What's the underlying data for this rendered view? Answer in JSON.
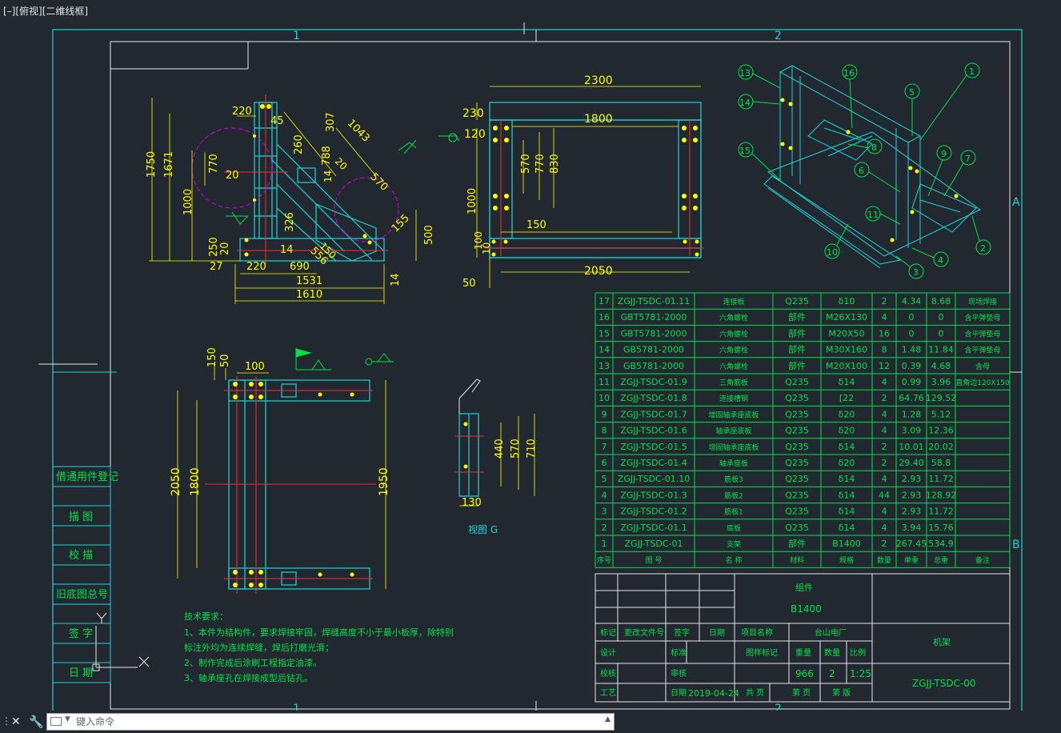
{
  "viewport_label": "[–][俯视][二维线框]",
  "command_line": {
    "placeholder": "键入命令",
    "close_icon": "close-icon",
    "settings_icon": "wrench-icon"
  },
  "frame": {
    "zone_cols": [
      "1",
      "2"
    ],
    "zone_rows": [
      "A",
      "B"
    ]
  },
  "side_stamp": [
    "借通用件登记",
    "描 图",
    "校 描",
    "旧底图总号",
    "签 字",
    "日 期"
  ],
  "dimensions": {
    "left_view": [
      "220",
      "45",
      "307",
      "1043",
      "260",
      "788",
      "20",
      "570",
      "770",
      "20",
      "1750",
      "1671",
      "1000",
      "326",
      "14",
      "150",
      "155",
      "500",
      "250",
      "20",
      "14",
      "27",
      "220",
      "690",
      "556",
      "1531",
      "1610",
      "14"
    ],
    "front_view": [
      "2300",
      "230",
      "1800",
      "120",
      "570",
      "770",
      "830",
      "1000",
      "150",
      "100",
      "10",
      "2050",
      "50"
    ],
    "plan_view": [
      "150",
      "50",
      "100",
      "2050",
      "1800",
      "1950"
    ],
    "view_g": [
      "440",
      "570",
      "710",
      "130"
    ]
  },
  "view_g_label": "视图 G",
  "balloons": [
    "13",
    "14",
    "15",
    "16",
    "5",
    "1",
    "8",
    "9",
    "7",
    "6",
    "11",
    "10",
    "3",
    "4",
    "2"
  ],
  "tech_notes": {
    "title": "技术要求：",
    "lines": [
      "1、本件为结构件，要求焊接牢固，焊缝高度不小于最小板厚，除特别",
      "标注外均为连续焊缝，焊后打磨光滑；",
      "2、制作完成后涂刷工程指定油漆。",
      "3、轴承座孔在焊接成型后钻孔。"
    ]
  },
  "bom": {
    "rows": [
      [
        "17",
        "ZGJJ-TSDC-01.11",
        "连接板",
        "Q235",
        "δ10",
        "2",
        "4.34",
        "8.68",
        "现场焊接"
      ],
      [
        "16",
        "GBT5781-2000",
        "六角螺栓",
        "部件",
        "M26X130",
        "4",
        "0",
        "0",
        "含平弹垫母"
      ],
      [
        "15",
        "GBT5781-2000",
        "六角螺栓",
        "部件",
        "M20X50",
        "16",
        "0",
        "0",
        "含平弹垫母"
      ],
      [
        "14",
        "GB5781-2000",
        "六角螺栓",
        "部件",
        "M30X160",
        "8",
        "1.48",
        "11.84",
        "含平弹垫母"
      ],
      [
        "13",
        "GB5781-2000",
        "六角螺栓",
        "部件",
        "M20X100",
        "12",
        "0.39",
        "4.68",
        "含母"
      ],
      [
        "11",
        "ZGJJ-TSDC-01.9",
        "三角筋板",
        "Q235",
        "δ14",
        "4",
        "0.99",
        "3.96",
        "直角边120X150"
      ],
      [
        "10",
        "ZGJJ-TSDC-01.8",
        "连接槽钢",
        "Q235",
        "[22",
        "2",
        "64.76",
        "129.52",
        ""
      ],
      [
        "9",
        "ZGJJ-TSDC-01.7",
        "增固轴承座底板",
        "Q235",
        "δ20",
        "4",
        "1.28",
        "5.12",
        ""
      ],
      [
        "8",
        "ZGJJ-TSDC-01.6",
        "轴承座底板",
        "Q235",
        "δ20",
        "4",
        "3.09",
        "12.36",
        ""
      ],
      [
        "7",
        "ZGJJ-TSDC-01.5",
        "增固轴承座底板",
        "Q235",
        "δ14",
        "2",
        "10.01",
        "20.02",
        ""
      ],
      [
        "6",
        "ZGJJ-TSDC-01.4",
        "轴承座板",
        "Q235",
        "δ20",
        "2",
        "29.40",
        "58.8",
        ""
      ],
      [
        "5",
        "ZGJJ-TSDC-01.10",
        "筋板3",
        "Q235",
        "δ14",
        "4",
        "2.93",
        "11.72",
        ""
      ],
      [
        "4",
        "ZGJJ-TSDC-01.3",
        "筋板2",
        "Q235",
        "δ14",
        "44",
        "2.93",
        "128.92",
        ""
      ],
      [
        "3",
        "ZGJJ-TSDC-01.2",
        "筋板1",
        "Q235",
        "δ14",
        "4",
        "2.93",
        "11.72",
        ""
      ],
      [
        "2",
        "ZGJJ-TSDC-01.1",
        "底板",
        "Q235",
        "δ14",
        "4",
        "3.94",
        "15.76",
        ""
      ],
      [
        "1",
        "ZGJJ-TSDC-01",
        "支架",
        "部件",
        "B1400",
        "2",
        "267.45",
        "534.9",
        ""
      ]
    ],
    "header": [
      "序号",
      "图 号",
      "名 称",
      "材料",
      "规格",
      "数量",
      "单重",
      "总重",
      "备注"
    ]
  },
  "title_block": {
    "assembly_label": "组件",
    "spec": "B1400",
    "project_label": "项目名称",
    "project_value": "台山电厂",
    "part_name": "机架",
    "drawing_no": "ZGJJ-TSDC-00",
    "r1": [
      "标记",
      "更改文件号",
      "签字",
      "日期"
    ],
    "r2_label": "设计",
    "r2_std": "标准",
    "r2_stdmark": "图样标记",
    "r2_weight": "重量",
    "r2_qty": "数量",
    "r2_scale": "比例",
    "r3_check": "校核",
    "r3_review": "审核",
    "weight": "966",
    "qty": "2",
    "scale": "1:25",
    "r4_process": "工艺",
    "r4_date_label": "日期",
    "date": "2019-04-24",
    "sheets_total": "共 页",
    "sheet_no": "第 页",
    "version": "第 版"
  },
  "colors": {
    "background": "#212830",
    "outline": "#20d4d4",
    "dimension": "#ffff00",
    "table": "#00e24a",
    "hidden": "#ff2a2a",
    "phantom": "#d400d4"
  }
}
